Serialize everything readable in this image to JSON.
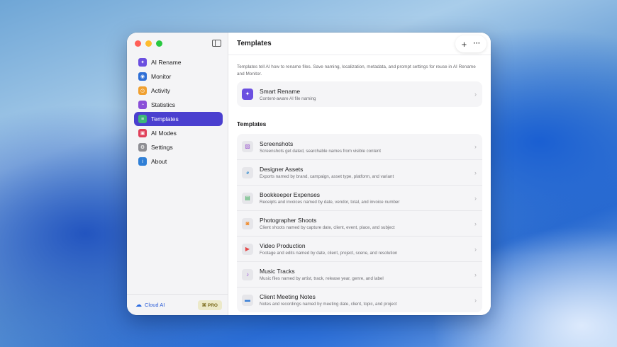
{
  "app": {
    "header_title": "Templates"
  },
  "sidebar": {
    "items": [
      {
        "label": "AI Rename",
        "icon": "sparkle-icon",
        "color": "#6b4fe0",
        "glyph": "✦"
      },
      {
        "label": "Monitor",
        "icon": "eye-icon",
        "color": "#2f6fd6",
        "glyph": "◉"
      },
      {
        "label": "Activity",
        "icon": "clock-icon",
        "color": "#f0a030",
        "glyph": "◷"
      },
      {
        "label": "Statistics",
        "icon": "pie-chart-icon",
        "color": "#8a4fd8",
        "glyph": "◔"
      },
      {
        "label": "Templates",
        "icon": "layers-icon",
        "color": "#3cb878",
        "glyph": "≡"
      },
      {
        "label": "AI Modes",
        "icon": "cpu-icon",
        "color": "#e0405a",
        "glyph": "▣"
      },
      {
        "label": "Settings",
        "icon": "gear-icon",
        "color": "#8e8e93",
        "glyph": "⚙"
      },
      {
        "label": "About",
        "icon": "info-icon",
        "color": "#2f7fd6",
        "glyph": "i"
      }
    ],
    "active_index": 4,
    "footer": {
      "cloud_label": "Cloud AI",
      "pro_label": "PRO",
      "pro_prefix": "⌘"
    }
  },
  "main": {
    "description": "Templates tell AI how to rename files. Save naming, localization, metadata, and prompt settings for reuse in AI Rename and Monitor.",
    "featured": {
      "title": "Smart Rename",
      "subtitle": "Content-aware AI file naming",
      "icon": "sparkle-icon",
      "color": "#6b4fe0"
    },
    "section_title": "Templates",
    "templates": [
      {
        "title": "Screenshots",
        "subtitle": "Screenshots get dated, searchable names from visible content",
        "icon": "photo-icon",
        "color": "#9b59d0",
        "glyph": "▨"
      },
      {
        "title": "Designer Assets",
        "subtitle": "Exports named by brand, campaign, asset type, platform, and variant",
        "icon": "palette-icon",
        "color": "#3a8fd0",
        "glyph": "◕"
      },
      {
        "title": "Bookkeeper Expenses",
        "subtitle": "Receipts and invoices named by date, vendor, total, and invoice number",
        "icon": "spreadsheet-icon",
        "color": "#3fae5c",
        "glyph": "▤"
      },
      {
        "title": "Photographer Shoots",
        "subtitle": "Client shoots named by capture date, client, event, place, and subject",
        "icon": "camera-icon",
        "color": "#f08a2a",
        "glyph": "◙"
      },
      {
        "title": "Video Production",
        "subtitle": "Footage and edits named by date, client, project, scene, and resolution",
        "icon": "play-icon",
        "color": "#e54848",
        "glyph": "▶"
      },
      {
        "title": "Music Tracks",
        "subtitle": "Music files named by artist, track, release year, genre, and label",
        "icon": "music-note-icon",
        "color": "#9a4fd8",
        "glyph": "♪"
      },
      {
        "title": "Client Meeting Notes",
        "subtitle": "Notes and recordings named by meeting date, client, topic, and project",
        "icon": "briefcase-icon",
        "color": "#3a7fd6",
        "glyph": "▬"
      }
    ]
  }
}
